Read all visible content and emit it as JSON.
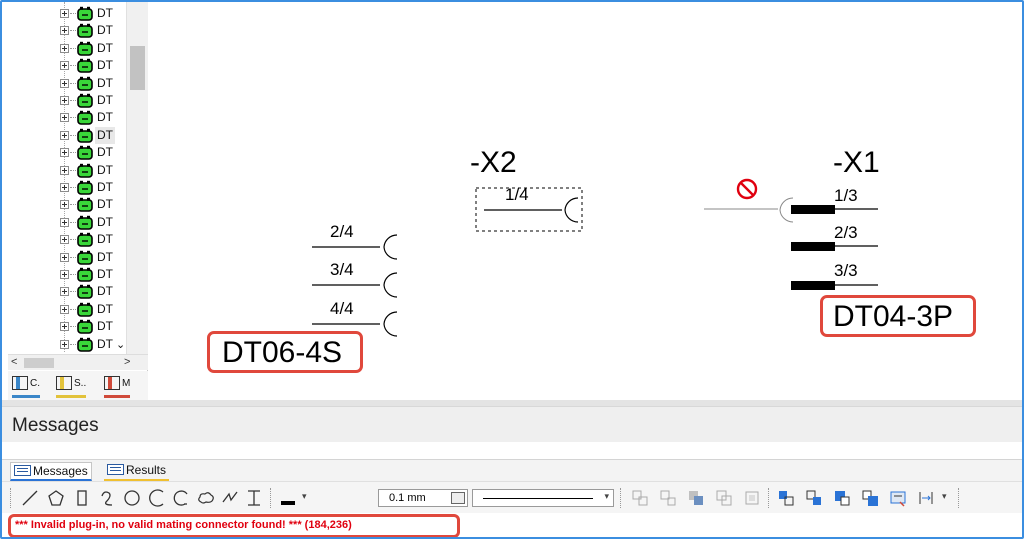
{
  "tree": {
    "item_label": "DT",
    "rows": [
      "DT",
      "DT",
      "DT",
      "DT",
      "DT",
      "DT",
      "DT",
      "DT",
      "DT",
      "DT",
      "DT",
      "DT",
      "DT",
      "DT",
      "DT",
      "DT",
      "DT",
      "DT",
      "DT",
      "DT"
    ],
    "last_row_label": "DT",
    "selected_index": 7,
    "tabs": [
      {
        "label": "C.",
        "color": "#3a86c8"
      },
      {
        "label": "S..",
        "color": "#e2c23a"
      },
      {
        "label": "M",
        "color": "#d04a3a"
      }
    ]
  },
  "canvas": {
    "connector_x2": {
      "name": "-X2",
      "pin": "1/4"
    },
    "connector_x1": {
      "name": "-X1",
      "pins": [
        "1/3",
        "2/3",
        "3/3"
      ],
      "part": "DT04-3P"
    },
    "connector_left": {
      "pins": [
        "2/4",
        "3/4",
        "4/4"
      ],
      "part": "DT06-4S"
    }
  },
  "messages": {
    "title": "Messages",
    "tabs": [
      {
        "label": "Messages",
        "active": true
      },
      {
        "label": "Results",
        "active": false
      }
    ],
    "error_text": "*** Invalid plug-in, no valid mating connector found! *** (184,236)",
    "line_width": "0.1 mm"
  },
  "toolbar": {
    "icons": [
      "line-icon",
      "polygon-icon",
      "rectangle-icon",
      "curve-icon",
      "circle-icon",
      "arc-icon",
      "arc2-icon",
      "cloud-icon",
      "freehand-icon",
      "dimension-icon",
      "color-icon"
    ],
    "right_icons": [
      "group-icon",
      "ungroup-icon",
      "bring-front-icon",
      "send-back-icon",
      "lock-icon",
      "align-left-icon",
      "align-right-icon",
      "align-top-icon",
      "align-bottom-icon",
      "properties-icon",
      "spacing-icon"
    ]
  },
  "colors": {
    "accent": "#3b8ee0",
    "error": "#e0000f",
    "highlight": "#e0483c",
    "connector_green": "#39d639"
  }
}
